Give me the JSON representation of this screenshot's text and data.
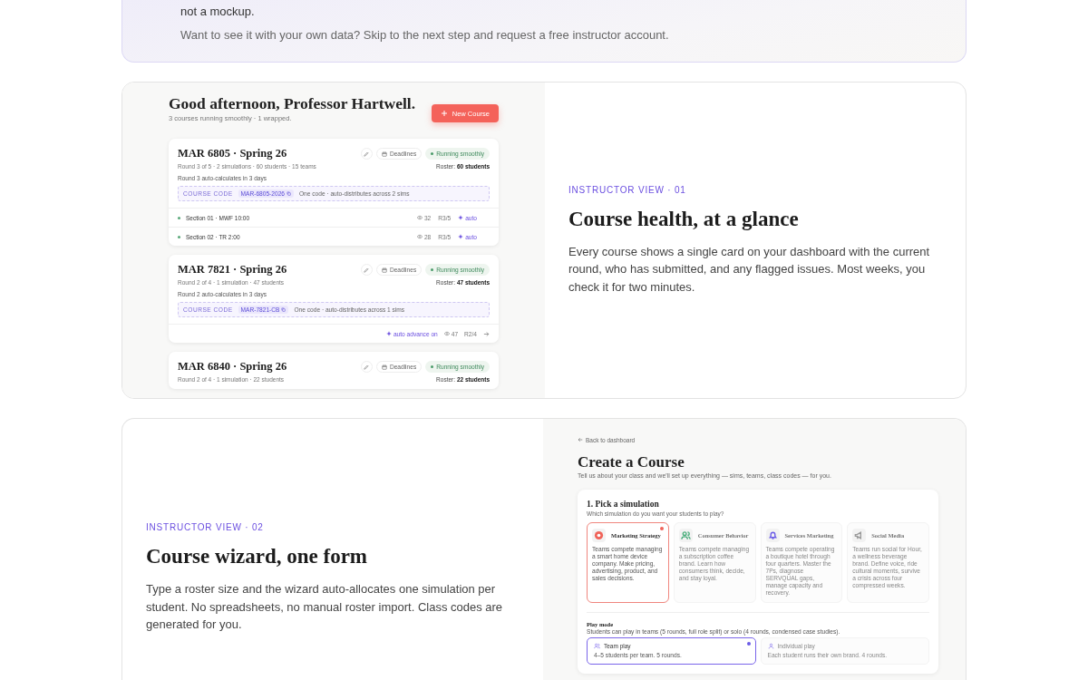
{
  "intro": {
    "lines": [
      "not a mockup.",
      "Want to see it with your own data? Skip to the next step and request a free instructor account."
    ]
  },
  "features": [
    {
      "kind": "dashboard",
      "eyebrow": "INSTRUCTOR VIEW · 01",
      "title": "Course health, at a glance",
      "body": "Every course shows a single card on your dashboard with the current round, who has submitted, and any flagged issues. Most weeks, you check it for two minutes.",
      "preview": {
        "greeting": "Good afternoon, Professor Hartwell.",
        "summary": "3 courses running smoothly · 1 wrapped.",
        "new_course": "New Course",
        "courses": [
          {
            "title": "MAR 6805 · Spring 26",
            "deadlines": "Deadlines",
            "status": "Running smoothly",
            "meta": "Round 3 of 5 · 2 simulations · 60 students · 15 teams",
            "roster": "Roster: **60 students**",
            "note": "Round 3 auto-calculates in 3 days",
            "code_label": "COURSE CODE",
            "code": "MAR-6805-2026",
            "code_note": "One code · auto-distributes across 2 sims",
            "sections": [
              {
                "name": "Section 01 · MWF 10:00",
                "count": "32",
                "round": "R3/5",
                "auto": "auto"
              },
              {
                "name": "Section 02 · TR 2:00",
                "count": "28",
                "round": "R3/5",
                "auto": "auto"
              }
            ]
          },
          {
            "title": "MAR 7821 · Spring 26",
            "deadlines": "Deadlines",
            "status": "Running smoothly",
            "meta": "Round 2 of 4 · 1 simulation · 47 students",
            "roster": "Roster: **47 students**",
            "note": "Round 2 auto-calculates in 3 days",
            "code_label": "COURSE CODE",
            "code": "MAR-7821-CB",
            "code_note": "One code · auto-distributes across 1 sims",
            "footer": {
              "auto": "auto advance on",
              "count": "47",
              "round": "R2/4"
            }
          },
          {
            "title": "MAR 6840 · Spring 26",
            "deadlines": "Deadlines",
            "status": "Running smoothly",
            "meta": "Round 2 of 4 · 1 simulation · 22 students",
            "roster": "Roster: **22 students**"
          }
        ]
      }
    },
    {
      "kind": "wizard",
      "eyebrow": "INSTRUCTOR VIEW · 02",
      "title": "Course wizard, one form",
      "body": "Type a roster size and the wizard auto-allocates one simulation per student. No spreadsheets, no manual roster import. Class codes are generated for you.",
      "preview": {
        "back": "Back to dashboard",
        "title": "Create a Course",
        "subtitle": "Tell us about your class and we'll set up everything — sims, teams, class codes — for you.",
        "step": "1. Pick a simulation",
        "question": "Which simulation do you want your students to play?",
        "sims": [
          {
            "name": "Marketing Strategy",
            "desc": "Teams compete managing a smart home device company. Make pricing, advertising, product, and sales decisions.",
            "selected": true,
            "color": "#f0645a"
          },
          {
            "name": "Consumer Behavior",
            "desc": "Teams compete managing a subscription coffee brand. Learn how consumers think, decide, and stay loyal.",
            "selected": false,
            "color": "#4caf7d"
          },
          {
            "name": "Services Marketing",
            "desc": "Teams compete operating a boutique hotel through four quarters. Master the 7Ps, diagnose SERVQUAL gaps, manage capacity and recovery.",
            "selected": false,
            "color": "#6b5ce7"
          },
          {
            "name": "Social Media",
            "desc": "Teams run social for Hour, a wellness beverage brand. Define voice, ride cultural moments, survive a crisis across four compressed weeks.",
            "selected": false,
            "color": "#9a9a9a"
          }
        ],
        "mode_title": "Play mode",
        "mode_desc": "Students can play in teams (5 rounds, full role split) or solo (4 rounds, condensed case studies).",
        "modes": [
          {
            "kind": "team",
            "name": "Team play",
            "desc": "4–5 students per team. 5 rounds.",
            "selected": true
          },
          {
            "kind": "solo",
            "name": "Individual play",
            "desc": "Each student runs their own brand. 4 rounds.",
            "selected": false
          }
        ]
      }
    }
  ]
}
